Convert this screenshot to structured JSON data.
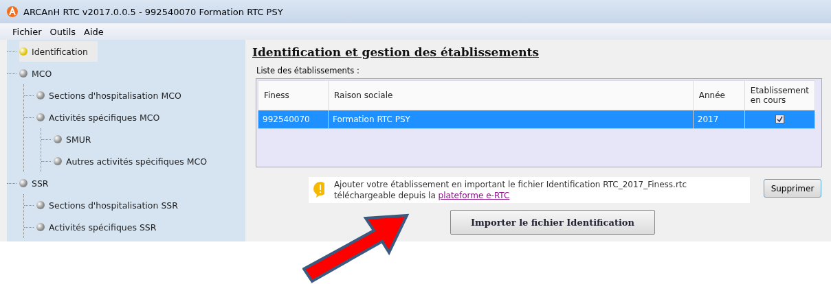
{
  "window": {
    "title": "ARCAnH RTC  v2017.0.0.5 - 992540070 Formation RTC PSY"
  },
  "menu": [
    "Fichier",
    "Outils",
    "Aide"
  ],
  "tree": [
    {
      "label": "Identification",
      "selected": true
    },
    {
      "label": "MCO",
      "selected": false,
      "children": [
        {
          "label": "Sections d'hospitalisation MCO",
          "selected": false
        },
        {
          "label": "Activités spécifiques MCO",
          "selected": false,
          "children": [
            {
              "label": "SMUR",
              "selected": false
            },
            {
              "label": "Autres activités spécifiques MCO",
              "selected": false
            }
          ]
        }
      ]
    },
    {
      "label": "SSR",
      "selected": false,
      "children": [
        {
          "label": "Sections d'hospitalisation SSR",
          "selected": false
        },
        {
          "label": "Activités spécifiques SSR",
          "selected": false
        }
      ]
    }
  ],
  "heading": "Identification et gestion des établissements",
  "group_label": "Liste des établissements :",
  "table": {
    "columns": [
      "Finess",
      "Raison sociale",
      "Année",
      "Etablissement en cours"
    ],
    "rows": [
      {
        "finess": "992540070",
        "raison_sociale": "Formation RTC PSY",
        "annee": "2017",
        "en_cours": true,
        "selected": true
      }
    ]
  },
  "info": {
    "text": "Ajouter votre établissement en important le fichier Identification RTC_2017_Finess.rtc téléchargeable depuis la ",
    "link": "plateforme e-RTC"
  },
  "delete_button": "Supprimer",
  "import_button": "Importer le fichier Identification"
}
